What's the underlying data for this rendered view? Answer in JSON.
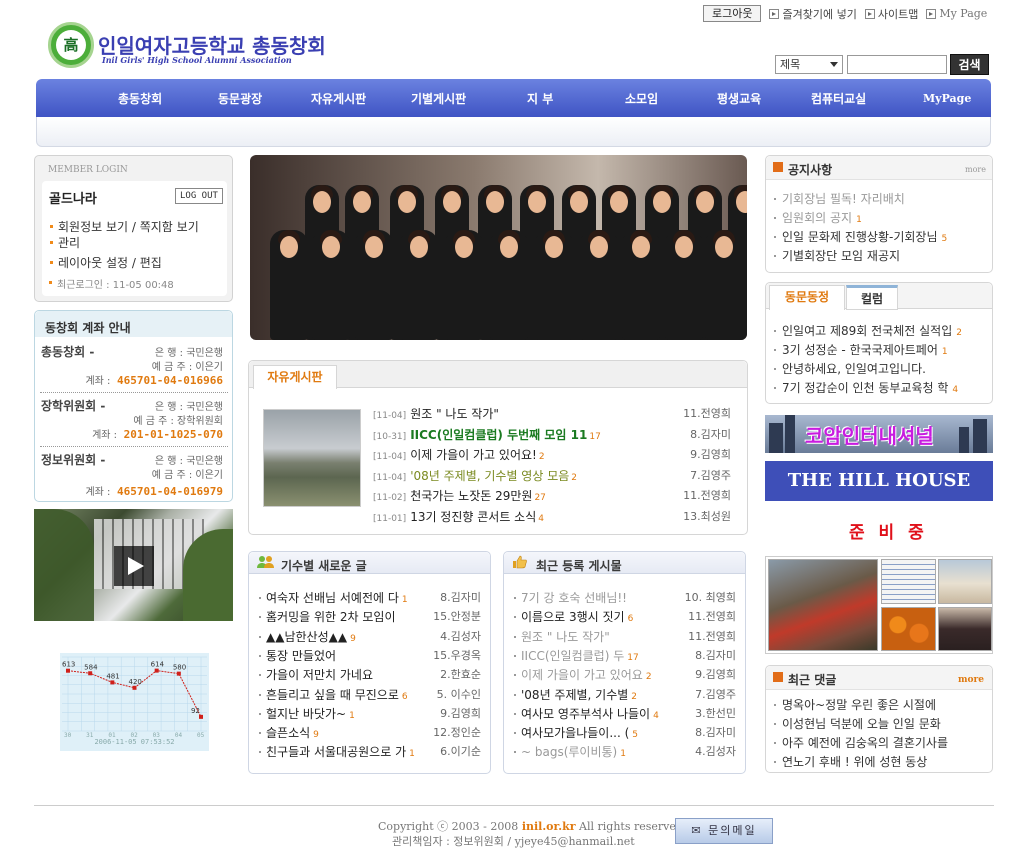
{
  "top": {
    "logout_label": "로그아웃",
    "bookmark_label": "즐겨찾기에 넣기",
    "sitemap_label": "사이트맵",
    "mypage_label": "My Page"
  },
  "logo": {
    "badge": "高",
    "title": "인일여자고등학교 총동창회",
    "subtitle": "Inil Girls' High School Alumni Association"
  },
  "search": {
    "select_value": "제목",
    "button_label": "검색",
    "input_value": ""
  },
  "nav": {
    "items": [
      "총동창회",
      "동문광장",
      "자유게시판",
      "기별게시판",
      "지 부",
      "소모임",
      "평생교육",
      "컴퓨터교실"
    ],
    "mypage": "MyPage"
  },
  "login": {
    "heading": "MEMBER LOGIN",
    "user_name": "골드나라",
    "logout_btn": "LOG OUT",
    "links": [
      "회원정보 보기 / 쪽지함 보기",
      "관리",
      "레이아웃 설정 / 편집"
    ],
    "last_login": "최근로그인 : 11-05 00:48"
  },
  "accounts": {
    "title": "동창회 계좌 안내",
    "rows": [
      {
        "name": "총동창회 -",
        "bank": "은 행 : 국민은행",
        "holder": "예 금 주 : 이은기",
        "num_label": "계좌 :",
        "num": "465701-04-016966"
      },
      {
        "name": "장학위원회 -",
        "bank": "은 행 : 국민은행",
        "holder": "예 금 주 : 장학위원회",
        "num_label": "계좌 :",
        "num": "201-01-1025-070"
      },
      {
        "name": "정보위원회 -",
        "bank": "은 행 : 국민은행",
        "holder": "예 금 주 : 이은기",
        "num_label": "계좌 :",
        "num": "465701-04-016979"
      }
    ]
  },
  "visitor_chart": {
    "caption": "2006-11-05 07:53:52"
  },
  "chart_data": {
    "type": "line",
    "categories": [
      "30",
      "31",
      "01",
      "02",
      "03",
      "04",
      "05"
    ],
    "values": [
      613,
      584,
      481,
      420,
      614,
      580,
      92
    ],
    "title": "",
    "xlabel": "",
    "ylabel": "",
    "ylim": [
      0,
      700
    ],
    "grid": true
  },
  "free_board": {
    "tab": "자유게시판",
    "rows": [
      {
        "date": "[11-04]",
        "title": "원조 \" 나도 작가\"",
        "count": "",
        "author": "11.전영희",
        "style": "normal"
      },
      {
        "date": "[10-31]",
        "title": "IICC(인일컴클럽) 두번째 모임 11",
        "count": "17",
        "author": "8.김자미",
        "style": "green"
      },
      {
        "date": "[11-04]",
        "title": "이제 가을이 가고 있어요!",
        "count": "2",
        "author": "9.김영희",
        "style": "normal"
      },
      {
        "date": "[11-04]",
        "title": "'08년 주제별, 기수별 영상 모음",
        "count": "2",
        "author": "7.김영주",
        "style": "olive"
      },
      {
        "date": "[11-02]",
        "title": "천국가는 노잣돈 29만원",
        "count": "27",
        "author": "11.전영희",
        "style": "normal"
      },
      {
        "date": "[11-01]",
        "title": "13기 정진향 콘서트 소식",
        "count": "4",
        "author": "13.최성원",
        "style": "normal"
      }
    ]
  },
  "gen_board": {
    "title": "기수별 새로운 글",
    "rows": [
      {
        "title": "여숙자 선배님 서예전에 다",
        "count": "1",
        "author": "8.김자미"
      },
      {
        "title": "홈커밍을 위한 2차 모임이",
        "count": "",
        "author": "15.안정분"
      },
      {
        "title": "▲▲남한산성▲▲",
        "count": "9",
        "author": "4.김성자"
      },
      {
        "title": "통장 만들었어",
        "count": "",
        "author": "15.우경옥"
      },
      {
        "title": "가을이 저만치 가네요",
        "count": "",
        "author": "2.한효순"
      },
      {
        "title": "흔들리고 싶을 때 무진으로",
        "count": "6",
        "author": "5. 이수인"
      },
      {
        "title": "헐지난 바닷가~",
        "count": "1",
        "author": "9.김영희"
      },
      {
        "title": "슬픈소식",
        "count": "9",
        "author": "12.정인순"
      },
      {
        "title": "친구들과 서울대공원으로 가",
        "count": "1",
        "author": "6.이기순"
      }
    ]
  },
  "recent_board": {
    "title": "최근 등록 게시물",
    "rows": [
      {
        "title": "7기 강 호숙 선배님!!",
        "count": "",
        "author": "10. 최영희",
        "gray": true
      },
      {
        "title": "이름으로 3행시 짓기",
        "count": "6",
        "author": "11.전영희",
        "gray": false
      },
      {
        "title": "원조 \" 나도 작가\"",
        "count": "",
        "author": "11.전영희",
        "gray": true
      },
      {
        "title": "IICC(인일컴클럽) 두",
        "count": "17",
        "author": "8.김자미",
        "gray": true
      },
      {
        "title": "이제 가을이 가고 있어요",
        "count": "2",
        "author": "9.김영희",
        "gray": true
      },
      {
        "title": "'08년 주제별, 기수별",
        "count": "2",
        "author": "7.김영주",
        "gray": false
      },
      {
        "title": "여사모 영주부석사 나들이",
        "count": "4",
        "author": "3.한선민",
        "gray": false
      },
      {
        "title": "여사모가을나들이... (",
        "count": "5",
        "author": "8.김자미",
        "gray": false
      },
      {
        "title": "~ bags(루이비통)",
        "count": "1",
        "author": "4.김성자",
        "gray": true
      }
    ]
  },
  "notice": {
    "title": "공지사항",
    "more": "more",
    "rows": [
      {
        "title": "기회장님 필독! 자리배치",
        "count": "",
        "gray": true
      },
      {
        "title": "임원회의 공지",
        "count": "1",
        "gray": true
      },
      {
        "title": "인일 문화제 진행상황-기회장님",
        "count": "5",
        "gray": false
      },
      {
        "title": "기별회장단 모임 재공지",
        "count": "",
        "gray": false
      }
    ]
  },
  "news": {
    "tab_active": "동문동정",
    "tab_other": "컬럼",
    "rows": [
      {
        "title": "인일여고 제89회 전국체전 실적입",
        "count": "2"
      },
      {
        "title": "3기 성정순 - 한국국제아트페어",
        "count": "1"
      },
      {
        "title": "안녕하세요, 인일여고입니다.",
        "count": ""
      },
      {
        "title": "7기 정갑순이 인천 동부교육청 학",
        "count": "4"
      }
    ]
  },
  "ads": {
    "ad1": "코암인터내셔널",
    "ad2": "THE HILL HOUSE",
    "soon": "준 비 중"
  },
  "comments": {
    "title": "최근 댓글",
    "more": "more",
    "rows": [
      "명옥아~정말 우린 좋은 시절에",
      "이성현님 덕분에 오늘 인일 문화",
      "아주 예전에 김숭옥의 결혼기사를",
      "연노기 후배 ! 위에 성현 동상"
    ]
  },
  "footer": {
    "copyright_pre": "Copyright ⓒ 2003 - 2008 ",
    "domain": "inil.or.kr",
    "copyright_post": " All rights reserved",
    "manager": "관리책임자 : 정보위원회 / ",
    "email": "yjeye45@hanmail.net",
    "mail_button": "문의메일"
  },
  "colors": {
    "nav": "#3f54c4",
    "accent": "#e07a10",
    "logo_green": "#4cae3a"
  }
}
